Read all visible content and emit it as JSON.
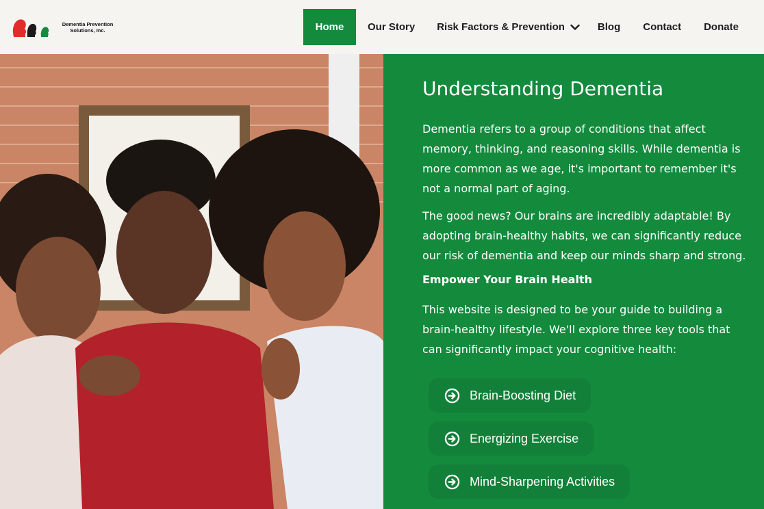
{
  "brand": {
    "name": "Dementia Prevention Solutions, Inc.",
    "line1": "Dementia Prevention",
    "line2": "Solutions, Inc.",
    "logo_icon": "heads-silhouette-logo",
    "colors": {
      "red": "#e32b2b",
      "black": "#1a1a1a",
      "green": "#148a3d"
    }
  },
  "nav": {
    "items": [
      {
        "label": "Home",
        "active": true
      },
      {
        "label": "Our Story"
      },
      {
        "label": "Risk Factors & Prevention",
        "icon": "chevron-down-icon"
      },
      {
        "label": "Blog"
      },
      {
        "label": "Contact"
      },
      {
        "label": "Donate"
      }
    ]
  },
  "hero": {
    "image_alt": "three-women-smiling-photo"
  },
  "content": {
    "title": "Understanding Dementia",
    "paragraph1": "Dementia refers to a group of conditions that affect memory, thinking, and reasoning skills. While dementia is more common as we age, it's important to remember it's not a normal part of aging.",
    "paragraph2": "The good news? Our brains are incredibly adaptable! By adopting brain-healthy habits, we can significantly reduce our risk of dementia and keep our minds sharp and strong.",
    "subheading": "Empower Your Brain Health",
    "paragraph3": "This website is designed to be your guide to building a brain-healthy lifestyle. We'll explore three key tools that can significantly impact your cognitive health:",
    "tools": [
      {
        "label": "Brain-Boosting Diet",
        "icon": "arrow-circle-right-icon"
      },
      {
        "label": "Energizing Exercise",
        "icon": "arrow-circle-right-icon"
      },
      {
        "label": "Mind-Sharpening Activities",
        "icon": "arrow-circle-right-icon"
      }
    ]
  },
  "theme": {
    "green": "#148a3d",
    "header_bg": "#f5f4f0"
  }
}
